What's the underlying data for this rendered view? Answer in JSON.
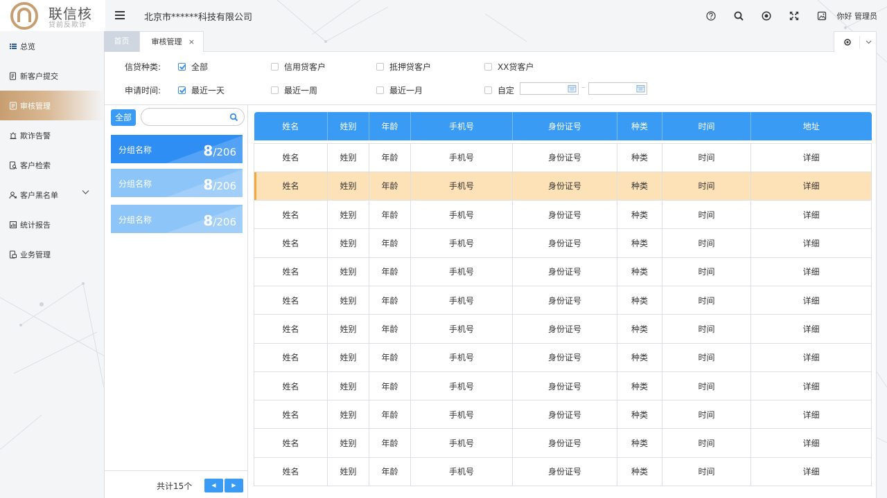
{
  "app": {
    "logo_title": "联信核",
    "logo_subtitle": "贷前反欺诈",
    "company": "北京市******科技有限公司",
    "greeting": "你好 管理员",
    "header_icons": [
      "help-icon",
      "search-icon",
      "target-icon",
      "fullscreen-icon",
      "picture-icon"
    ]
  },
  "sidebar": {
    "items": [
      {
        "label": "总览",
        "icon": "grid-icon"
      },
      {
        "label": "新客户提交",
        "icon": "document-icon"
      },
      {
        "label": "审核管理",
        "icon": "audit-icon",
        "active": true
      },
      {
        "label": "欺诈告警",
        "icon": "alarm-icon"
      },
      {
        "label": "客户检索",
        "icon": "search-doc-icon"
      },
      {
        "label": "客户黑名单",
        "icon": "user-icon",
        "expandable": true
      },
      {
        "label": "统计报告",
        "icon": "report-icon"
      },
      {
        "label": "业务管理",
        "icon": "briefcase-icon"
      }
    ]
  },
  "tabs": {
    "home": "首页",
    "audit": "审核管理",
    "close": "×"
  },
  "filters": {
    "type_label": "信贷种类:",
    "type_options": [
      {
        "label": "全部",
        "checked": true
      },
      {
        "label": "信用贷客户",
        "checked": false
      },
      {
        "label": "抵押贷客户",
        "checked": false
      },
      {
        "label": "XX贷客户",
        "checked": false
      }
    ],
    "time_label": "申请时间:",
    "time_options": [
      {
        "label": "最近一天",
        "checked": true
      },
      {
        "label": "最近一周",
        "checked": false
      },
      {
        "label": "最近一月",
        "checked": false
      },
      {
        "label": "自定",
        "checked": false
      }
    ],
    "date_separator": "–"
  },
  "groups": {
    "all_label": "全部",
    "search_placeholder": "",
    "items": [
      {
        "name": "分组名称",
        "count": "8",
        "total": "/206"
      },
      {
        "name": "分组名称",
        "count": "8",
        "total": "/206"
      },
      {
        "name": "分组名称",
        "count": "8",
        "total": "/206"
      }
    ],
    "footer_total": "共计15个",
    "prev": "◀",
    "next": "▶"
  },
  "table": {
    "headers": [
      "姓名",
      "姓别",
      "年龄",
      "手机号",
      "身份证号",
      "种类",
      "时间",
      "地址"
    ],
    "rows": [
      [
        "姓名",
        "姓别",
        "年龄",
        "手机号",
        "身份证号",
        "种类",
        "时间",
        "详细"
      ],
      [
        "姓名",
        "姓别",
        "年龄",
        "手机号",
        "身份证号",
        "种类",
        "时间",
        "详细"
      ],
      [
        "姓名",
        "姓别",
        "年龄",
        "手机号",
        "身份证号",
        "种类",
        "时间",
        "详细"
      ],
      [
        "姓名",
        "姓别",
        "年龄",
        "手机号",
        "身份证号",
        "种类",
        "时间",
        "详细"
      ],
      [
        "姓名",
        "姓别",
        "年龄",
        "手机号",
        "身份证号",
        "种类",
        "时间",
        "详细"
      ],
      [
        "姓名",
        "姓别",
        "年龄",
        "手机号",
        "身份证号",
        "种类",
        "时间",
        "详细"
      ],
      [
        "姓名",
        "姓别",
        "年龄",
        "手机号",
        "身份证号",
        "种类",
        "时间",
        "详细"
      ],
      [
        "姓名",
        "姓别",
        "年龄",
        "手机号",
        "身份证号",
        "种类",
        "时间",
        "详细"
      ],
      [
        "姓名",
        "姓别",
        "年龄",
        "手机号",
        "身份证号",
        "种类",
        "时间",
        "详细"
      ],
      [
        "姓名",
        "姓别",
        "年龄",
        "手机号",
        "身份证号",
        "种类",
        "时间",
        "详细"
      ],
      [
        "姓名",
        "姓别",
        "年龄",
        "手机号",
        "身份证号",
        "种类",
        "时间",
        "详细"
      ],
      [
        "姓名",
        "姓别",
        "年龄",
        "手机号",
        "身份证号",
        "种类",
        "时间",
        "详细"
      ]
    ],
    "highlighted_row": 1
  },
  "colors": {
    "accent": "#3a9bf5",
    "sidebar_active": "#c79e70",
    "row_highlight": "#fde1b7"
  }
}
